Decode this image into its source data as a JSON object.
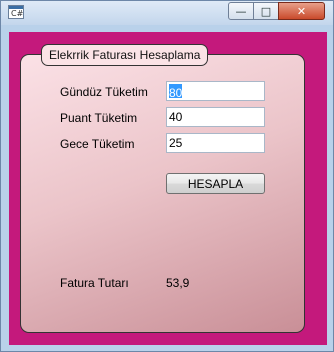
{
  "window": {
    "icon_glyph": "C#"
  },
  "titlebar": {
    "minimize_glyph": "—",
    "maximize_glyph": "□",
    "close_glyph": "✕"
  },
  "group": {
    "title": "Elekrrik Faturası Hesaplama"
  },
  "form": {
    "gunduz": {
      "label": "Gündüz Tüketim",
      "value": "80",
      "selected": true
    },
    "puant": {
      "label": "Puant Tüketim",
      "value": "40"
    },
    "gece": {
      "label": "Gece Tüketim",
      "value": "25"
    },
    "calculate_label": "HESAPLA",
    "result_label": "Fatura Tutarı",
    "result_value": "53,9"
  },
  "colors": {
    "client_background": "#c4197c",
    "selection": "#3399ff"
  }
}
